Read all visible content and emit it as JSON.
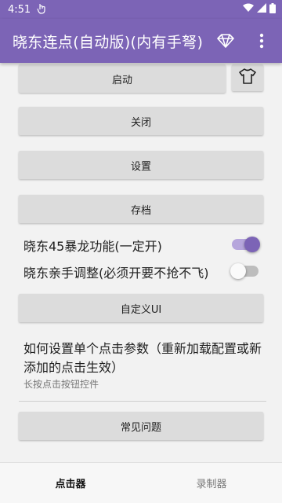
{
  "status_bar": {
    "time": "4:51",
    "icons": [
      "hand-icon",
      "wifi-icon",
      "signal-icon",
      "battery-icon"
    ]
  },
  "app_bar": {
    "title": "晓东连点(自动版)(内有手弩)",
    "actions": [
      "diamond-icon",
      "more-vert-icon"
    ]
  },
  "main": {
    "start_label": "启动",
    "close_label": "关闭",
    "settings_label": "设置",
    "save_label": "存档",
    "switches": [
      {
        "label": "晓东45暴龙功能(一定开)",
        "checked": true
      },
      {
        "label": "晓东亲手调整(必须开要不抢不飞)",
        "checked": false
      }
    ],
    "custom_ui_label": "自定义UI",
    "preference": {
      "title": "如何设置单个点击参数（重新加载配置或新添加的点击生效）",
      "summary": "长按点击按钮控件"
    },
    "faq_label": "常见问题"
  },
  "bottom_nav": {
    "tabs": [
      {
        "label": "点击器",
        "active": true
      },
      {
        "label": "录制器",
        "active": false
      }
    ]
  },
  "colors": {
    "primary": "#7c64b6",
    "switch_track_on": "#b6a6dc",
    "button_bg": "#dcdcdc"
  }
}
